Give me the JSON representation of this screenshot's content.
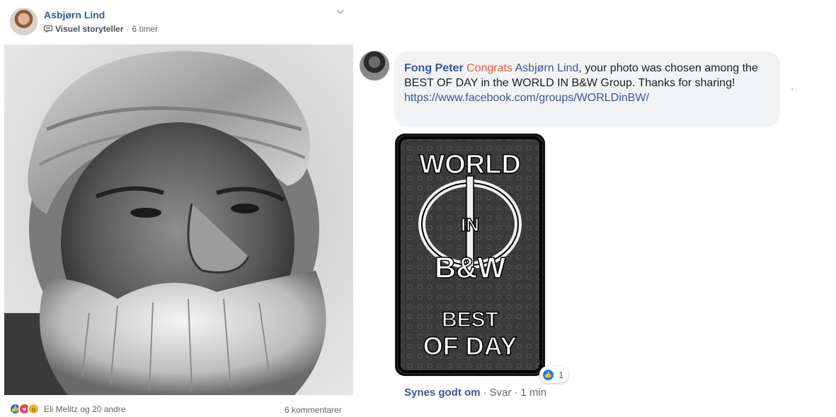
{
  "post": {
    "author": "Asbjørn Lind",
    "badge": "Visuel storyteller",
    "time": "6 timer",
    "meta_separator": "·",
    "reactions_text": "Eli Melitz og 20 andre",
    "comments_count": "6 kommentarer"
  },
  "comment": {
    "author": "Fong Peter",
    "highlight": "Congrats",
    "mention": "Asbjørn Lind",
    "text": ", your photo was chosen among the BEST OF DAY in the WORLD IN B&W Group. Thanks for sharing!",
    "link": "https://www.facebook.com/groups/WORLDinBW/",
    "sticker": {
      "line1": "WORLD",
      "line2": "IN",
      "line3": "B&W",
      "line4": "BEST",
      "line5": "OF DAY"
    },
    "like_count": "1",
    "like_action": "Synes godt om",
    "reply_action": "Svar",
    "time": "1 min",
    "separator": "·"
  },
  "colors": {
    "link_blue": "#385898",
    "congrats_orange": "#f0573f",
    "bubble_bg": "#f2f3f5",
    "meta_gray": "#606770",
    "like_blue": "#1877f2"
  }
}
